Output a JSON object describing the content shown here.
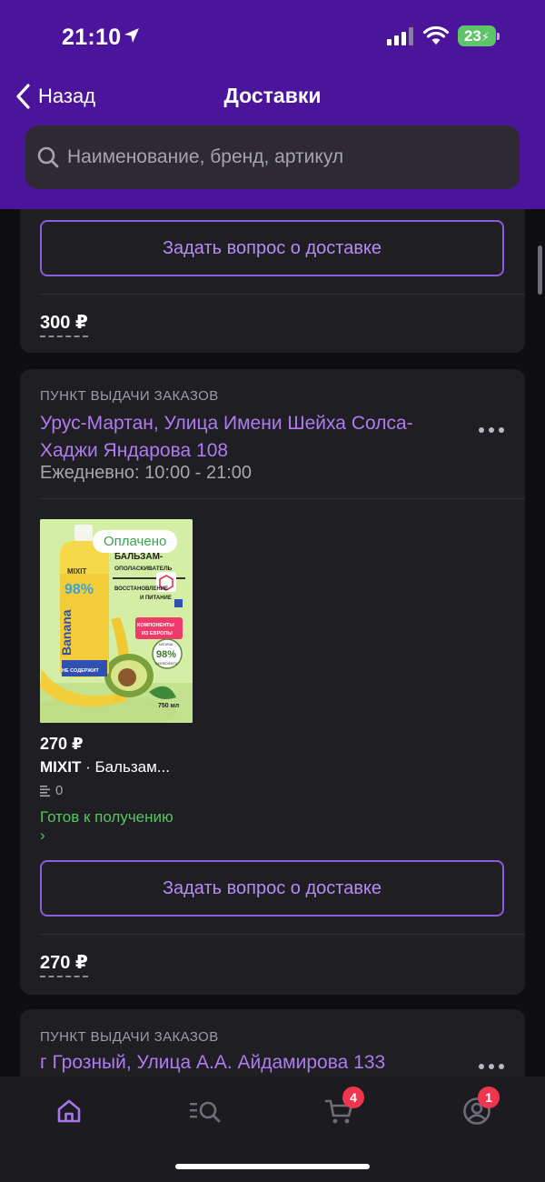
{
  "status_bar": {
    "time": "21:10",
    "battery": "23"
  },
  "nav": {
    "back_label": "Назад",
    "title": "Доставки"
  },
  "search": {
    "placeholder": "Наименование, бренд, артикул"
  },
  "card1": {
    "ask_label": "Задать вопрос о доставке",
    "total": "300 ₽"
  },
  "card2": {
    "pickup_label": "ПУНКТ ВЫДАЧИ ЗАКАЗОВ",
    "address": "Урус-Мартан, Улица Имени Шейха Солса-Хаджи Яндарова 108",
    "hours": "Ежедневно: 10:00 - 21:00",
    "product": {
      "badge": "Оплачено",
      "price": "270 ₽",
      "brand": "MIXIT",
      "name": " · Бальзам...",
      "qty": "0",
      "status": "Готов к получению",
      "status_chevron": "›",
      "image_text": {
        "logo": "MIXIT",
        "percent": "98%",
        "banana": "Banana",
        "title1": "БАЛЬЗАМ-",
        "title2": "ОПОЛАСКИВАТЕЛЬ",
        "title3": "ВОССТАНОВЛЕНИЕ",
        "title4": "И ПИТАНИЕ",
        "components1": "КОМПОНЕНТЫ",
        "components2": "ИЗ ЕВРОПЫ",
        "natural": "NATURAL",
        "natural_pct": "98%",
        "ingredients": "INGREDIENTS",
        "not_contain": "НЕ СОДЕРЖИТ",
        "volume": "750 мл"
      }
    },
    "ask_label": "Задать вопрос о доставке",
    "total": "270 ₽"
  },
  "card3": {
    "pickup_label": "ПУНКТ ВЫДАЧИ ЗАКАЗОВ",
    "address": "г Грозный, Улица А.А. Айдамирова 133"
  },
  "tabbar": {
    "tabs": [
      {
        "icon": "home-icon",
        "active": true
      },
      {
        "icon": "catalog-search-icon",
        "active": false
      },
      {
        "icon": "cart-icon",
        "active": false,
        "badge": "4"
      },
      {
        "icon": "profile-icon",
        "active": false,
        "badge": "1"
      }
    ]
  },
  "colors": {
    "header": "#4a159a",
    "accent": "#b07bf0",
    "card": "#1f1e23",
    "ready": "#53c65f",
    "badge": "#f0354f"
  }
}
